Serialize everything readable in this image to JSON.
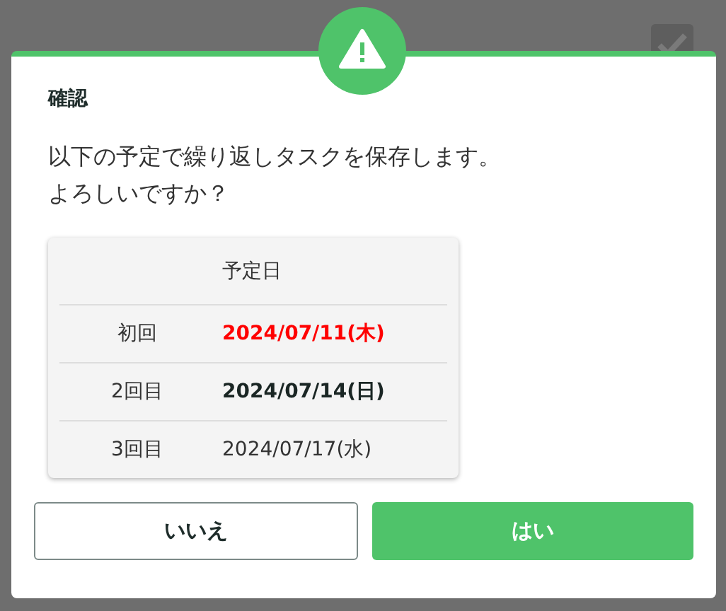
{
  "background": {
    "checkbox": {
      "checked": true
    }
  },
  "dialog": {
    "title": "確認",
    "message": [
      "以下の予定で繰り返しタスクを保存します。",
      "よろしいですか？"
    ],
    "table": {
      "columns": [
        "",
        "予定日"
      ],
      "rows": [
        {
          "label": "初回",
          "date": "2024/07/11(木)",
          "kind": "alert"
        },
        {
          "label": "2回目",
          "date": "2024/07/14(日)",
          "kind": "strong"
        },
        {
          "label": "3回目",
          "date": "2024/07/17(水)",
          "kind": "plain"
        }
      ]
    },
    "buttons": [
      {
        "label": "いいえ",
        "kind": "secondary"
      },
      {
        "label": "はい",
        "kind": "primary"
      }
    ]
  }
}
